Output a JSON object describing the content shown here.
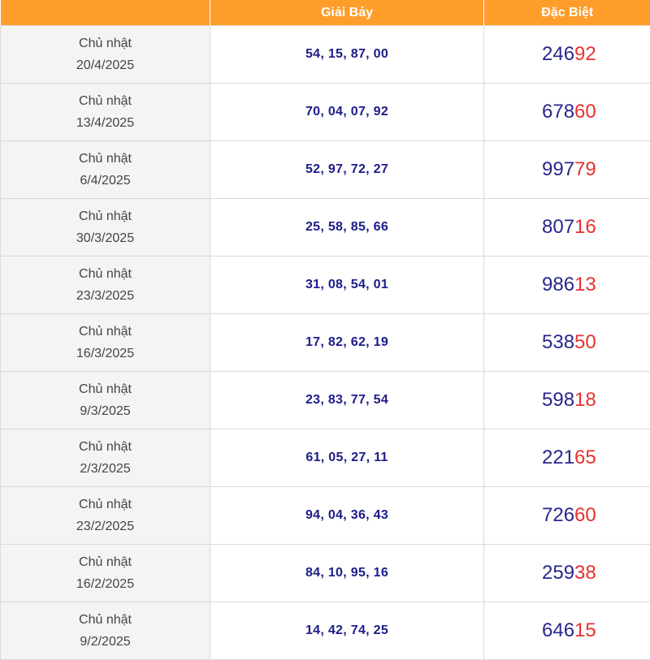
{
  "headers": {
    "date": "",
    "giai_bay": "Giải Bảy",
    "dac_biet": "Đặc Biệt"
  },
  "colors": {
    "header_bg": "#ff9d2b",
    "prize_blue": "#1c1c8a",
    "special_red": "#e8302f"
  },
  "rows": [
    {
      "weekday": "Chủ nhật",
      "date": "20/4/2025",
      "giai_bay": "54, 15, 87, 00",
      "special_head": "246",
      "special_tail": "92"
    },
    {
      "weekday": "Chủ nhật",
      "date": "13/4/2025",
      "giai_bay": "70, 04, 07, 92",
      "special_head": "678",
      "special_tail": "60"
    },
    {
      "weekday": "Chủ nhật",
      "date": "6/4/2025",
      "giai_bay": "52, 97, 72, 27",
      "special_head": "997",
      "special_tail": "79"
    },
    {
      "weekday": "Chủ nhật",
      "date": "30/3/2025",
      "giai_bay": "25, 58, 85, 66",
      "special_head": "807",
      "special_tail": "16"
    },
    {
      "weekday": "Chủ nhật",
      "date": "23/3/2025",
      "giai_bay": "31, 08, 54, 01",
      "special_head": "986",
      "special_tail": "13"
    },
    {
      "weekday": "Chủ nhật",
      "date": "16/3/2025",
      "giai_bay": "17, 82, 62, 19",
      "special_head": "538",
      "special_tail": "50"
    },
    {
      "weekday": "Chủ nhật",
      "date": "9/3/2025",
      "giai_bay": "23, 83, 77, 54",
      "special_head": "598",
      "special_tail": "18"
    },
    {
      "weekday": "Chủ nhật",
      "date": "2/3/2025",
      "giai_bay": "61, 05, 27, 11",
      "special_head": "221",
      "special_tail": "65"
    },
    {
      "weekday": "Chủ nhật",
      "date": "23/2/2025",
      "giai_bay": "94, 04, 36, 43",
      "special_head": "726",
      "special_tail": "60"
    },
    {
      "weekday": "Chủ nhật",
      "date": "16/2/2025",
      "giai_bay": "84, 10, 95, 16",
      "special_head": "259",
      "special_tail": "38"
    },
    {
      "weekday": "Chủ nhật",
      "date": "9/2/2025",
      "giai_bay": "14, 42, 74, 25",
      "special_head": "646",
      "special_tail": "15"
    }
  ]
}
